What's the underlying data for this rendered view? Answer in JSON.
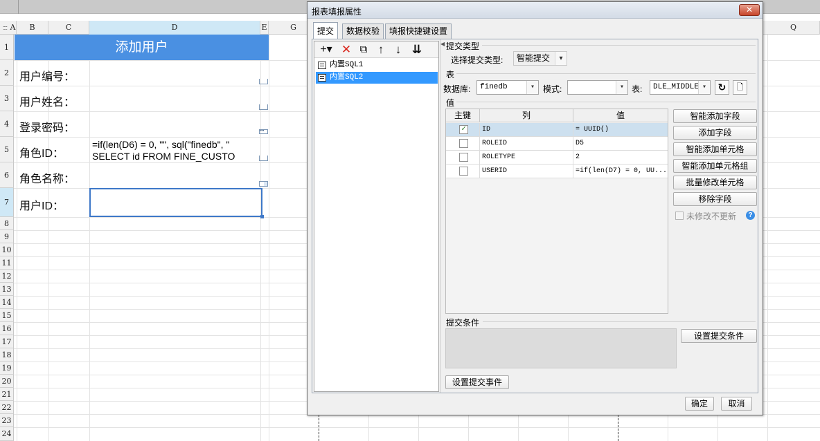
{
  "sheet": {
    "corner": "::::",
    "columns": [
      "A",
      "B",
      "C",
      "D",
      "E",
      "G",
      "Q"
    ],
    "rows": [
      "1",
      "2",
      "3",
      "4",
      "5",
      "6",
      "7",
      "8",
      "9",
      "10",
      "11",
      "12",
      "13",
      "14",
      "15",
      "16",
      "17",
      "18",
      "19",
      "20",
      "21",
      "22",
      "23",
      "24"
    ],
    "title": "添加用户",
    "labels": [
      "用户编号：",
      "用户姓名：",
      "登录密码：",
      "角色ID：",
      "角色名称：",
      "用户ID："
    ],
    "formula_line1": "=if(len(D6) = 0, \"\", sql(\"finedb\", \"",
    "formula_line2": "SELECT id FROM  FINE_CUSTO",
    "widget_dots": "•••"
  },
  "dialog": {
    "title": "报表填报属性",
    "close": "✕",
    "tabs": [
      "提交",
      "数据校验",
      "填报快捷键设置"
    ],
    "toolbar_icons": [
      "add-icon",
      "delete-icon",
      "copy-icon",
      "move-up-icon",
      "move-down-icon",
      "move-bottom-icon"
    ],
    "toolbar_glyphs": [
      "+▾",
      "✕",
      "⧉",
      "↑",
      "↓",
      "⇊"
    ],
    "collapse": "◀",
    "sql_items": [
      "内置SQL1",
      "内置SQL2"
    ],
    "submit_type": {
      "section": "提交类型",
      "label": "选择提交类型:",
      "value": "智能提交"
    },
    "table_section": {
      "section": "表",
      "db_label": "数据库:",
      "db_value": "finedb",
      "schema_label": "模式:",
      "schema_value": "",
      "table_label": "表:",
      "table_value": "DLE_MIDDLE",
      "refresh": "↻",
      "preview": "🗋"
    },
    "values_section": {
      "section": "值",
      "headers": [
        "主键",
        "列",
        "值"
      ],
      "rows": [
        {
          "key": "✓",
          "column": "ID",
          "value": "= UUID()"
        },
        {
          "key": "",
          "column": "ROLEID",
          "value": "D5"
        },
        {
          "key": "",
          "column": "ROLETYPE",
          "value": "2"
        },
        {
          "key": "",
          "column": "USERID",
          "value": "=if(len(D7) = 0, UU..."
        }
      ]
    },
    "side_buttons": [
      "智能添加字段",
      "添加字段",
      "智能添加单元格",
      "智能添加单元格组",
      "批量修改单元格",
      "移除字段"
    ],
    "unmodified_label": "未修改不更新",
    "help": "?",
    "condition": {
      "section": "提交条件",
      "button": "设置提交条件"
    },
    "event_button": "设置提交事件",
    "ok": "确定",
    "cancel": "取消"
  },
  "colors": {
    "title_fill": "#4a90e2",
    "selection": "#3399ff",
    "active_border": "#3e78c8"
  }
}
